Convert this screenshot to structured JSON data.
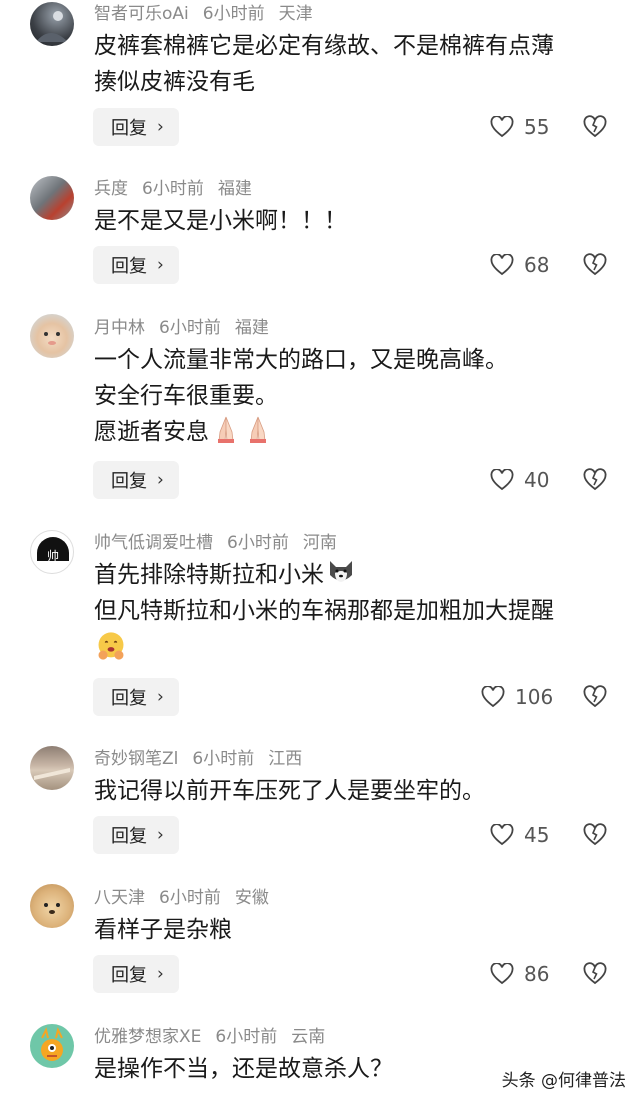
{
  "colors": {
    "meta": "#8a8a8a",
    "text": "#1a1a1a",
    "reply_bg": "#f2f2f2"
  },
  "reply_label": "回复",
  "comments": [
    {
      "user": "智者可乐oAi",
      "time": "6小时前",
      "location": "天津",
      "lines": [
        "皮裤套棉裤它是必定有缘故、不是棉裤有点薄",
        "揍似皮裤没有毛"
      ],
      "likes": "55"
    },
    {
      "user": "兵度",
      "time": "6小时前",
      "location": "福建",
      "lines": [
        "是不是又是小米啊！！！"
      ],
      "likes": "68"
    },
    {
      "user": "月中林",
      "time": "6小时前",
      "location": "福建",
      "lines": [
        "一个人流量非常大的路口，又是晚高峰。",
        "安全行车很重要。",
        "愿逝者安息"
      ],
      "emojis": [
        "pray-emoji",
        "pray-emoji"
      ],
      "likes": "40"
    },
    {
      "user": "帅气低调爱吐槽",
      "time": "6小时前",
      "location": "河南",
      "lines": [
        "首先排除特斯拉和小米",
        "但凡特斯拉和小米的车祸那都是加粗加大提醒"
      ],
      "emojis": [
        "husky-emoji",
        "hugging-face-emoji"
      ],
      "likes": "106",
      "avatar_text": "帅"
    },
    {
      "user": "奇妙钢笔Zl",
      "time": "6小时前",
      "location": "江西",
      "lines": [
        "我记得以前开车压死了人是要坐牢的。"
      ],
      "likes": "45"
    },
    {
      "user": "八天津",
      "time": "6小时前",
      "location": "安徽",
      "lines": [
        "看样子是杂粮"
      ],
      "likes": "86"
    },
    {
      "user": "优雅梦想家XE",
      "time": "6小时前",
      "location": "云南",
      "lines": [
        "是操作不当，还是故意杀人？"
      ]
    }
  ],
  "watermark": "头条 @何律普法"
}
